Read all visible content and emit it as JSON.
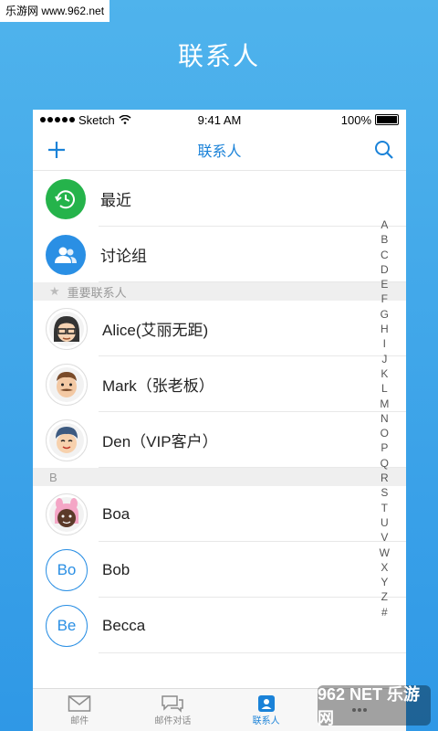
{
  "watermark_top": "乐游网 www.962.net",
  "promo_title": "联系人",
  "statusbar": {
    "carrier": "Sketch",
    "time": "9:41 AM",
    "battery": "100%"
  },
  "nav": {
    "title": "联系人"
  },
  "groups": [
    {
      "label": "最近",
      "icon": "recent-icon",
      "color": "#25b34b"
    },
    {
      "label": "讨论组",
      "icon": "group-icon",
      "color": "#2a8fe4"
    }
  ],
  "starred": {
    "header": "重要联系人",
    "items": [
      {
        "name": "Alice(艾丽无距)"
      },
      {
        "name": "Mark（张老板）"
      },
      {
        "name": "Den（VIP客户）"
      }
    ]
  },
  "section_b": {
    "header": "B",
    "items": [
      {
        "name": "Boa",
        "initials": ""
      },
      {
        "name": "Bob",
        "initials": "Bo"
      },
      {
        "name": "Becca",
        "initials": "Be"
      }
    ]
  },
  "index": [
    "A",
    "B",
    "C",
    "D",
    "E",
    "F",
    "G",
    "H",
    "I",
    "J",
    "K",
    "L",
    "M",
    "N",
    "O",
    "P",
    "Q",
    "R",
    "S",
    "T",
    "U",
    "V",
    "W",
    "X",
    "Y",
    "Z",
    "#"
  ],
  "tabs": [
    {
      "label": "邮件",
      "icon": "mail-icon"
    },
    {
      "label": "邮件对话",
      "icon": "chat-icon"
    },
    {
      "label": "联系人",
      "icon": "contacts-icon",
      "active": true
    },
    {
      "label": "",
      "icon": "more-icon"
    }
  ],
  "watermark_br": "962 NET 乐游网",
  "colors": {
    "accent": "#1a82d8",
    "green": "#25b34b",
    "blue": "#2a8fe4"
  }
}
